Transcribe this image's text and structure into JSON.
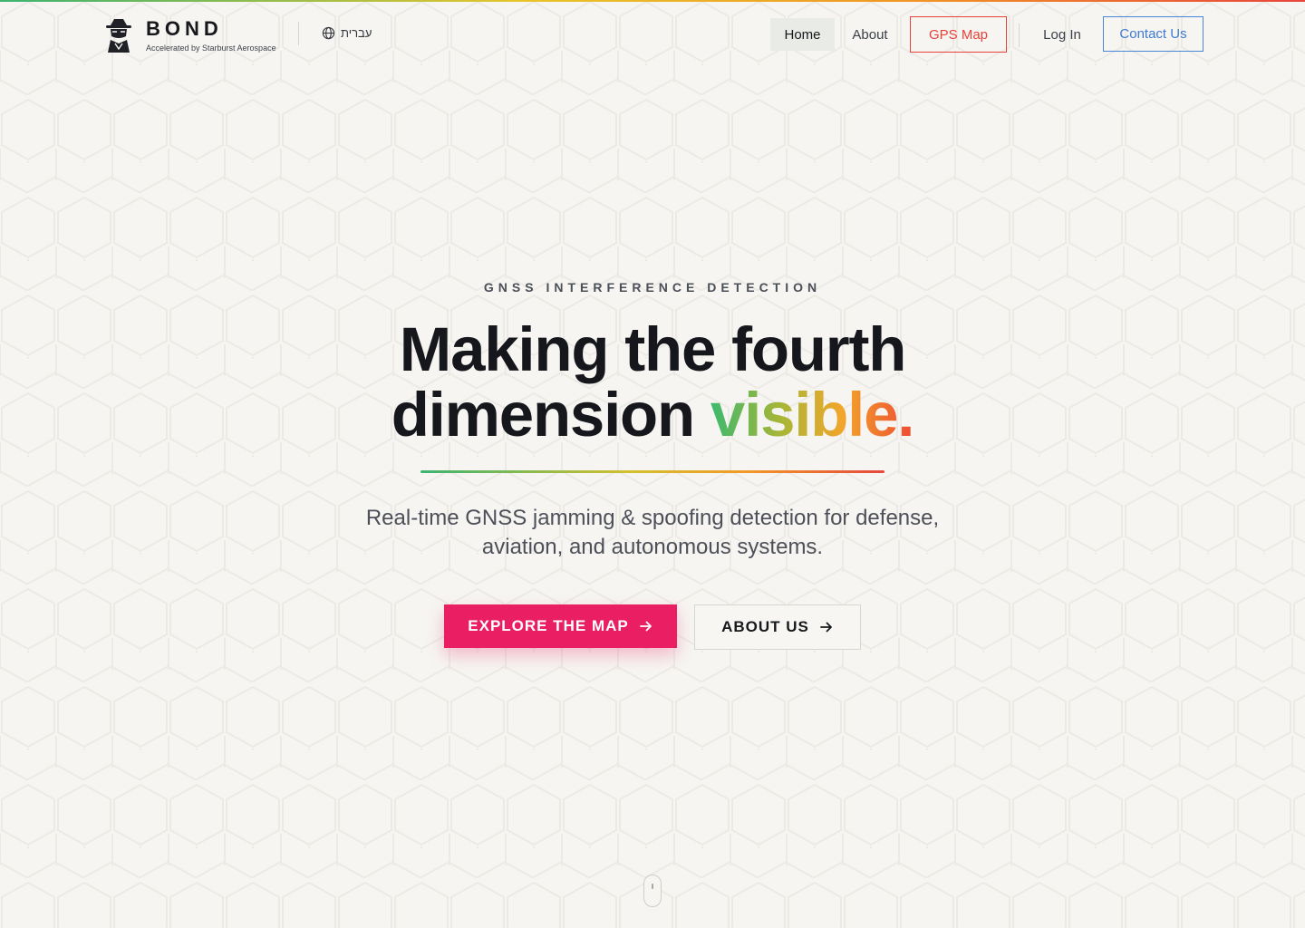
{
  "brand": {
    "name": "BOND",
    "tagline": "Accelerated by Starburst Aerospace",
    "logo_icon": "spy-agent-icon"
  },
  "language": {
    "label": "עברית",
    "icon": "globe-icon"
  },
  "nav": {
    "home": "Home",
    "about": "About",
    "gps_map": "GPS Map",
    "login": "Log In",
    "contact": "Contact Us",
    "active": "Home"
  },
  "hero": {
    "eyebrow": "GNSS INTERFERENCE DETECTION",
    "headline_line1": "Making the fourth",
    "headline_line2_prefix": "dimension",
    "headline_accent": "visible.",
    "subtitle_line1": "Real-time GNSS jamming & spoofing detection for defense,",
    "subtitle_line2": "aviation, and autonomous systems.",
    "cta_primary": "EXPLORE THE MAP",
    "cta_secondary": "ABOUT US",
    "arrow_icon": "arrow-right-icon"
  },
  "colors": {
    "background": "#f6f5f2",
    "primary_cta": "#ea1f63",
    "gps_map_accent": "#e64239",
    "contact_accent": "#3f7bd1",
    "gradient": [
      "#3cb371",
      "#e8c52a",
      "#f19524",
      "#e8453c"
    ]
  },
  "scroll_indicator": "mouse-scroll-icon"
}
